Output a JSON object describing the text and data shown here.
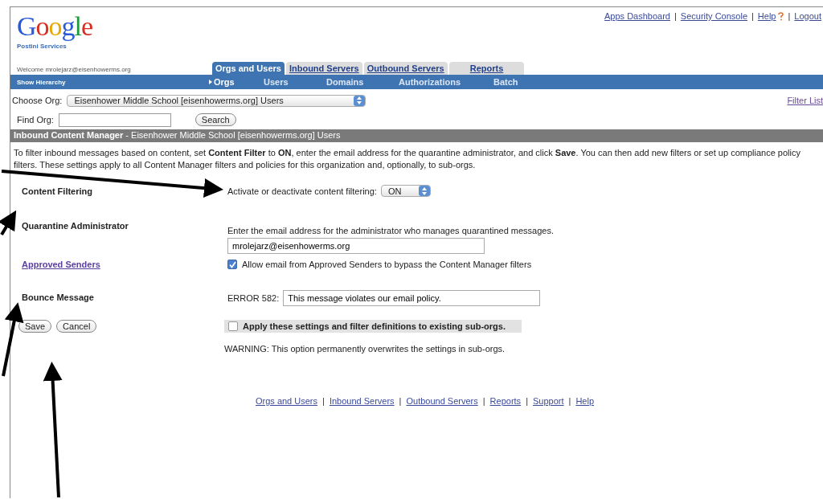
{
  "logo": {
    "wordmark": "Google",
    "subtitle": "Postini Services"
  },
  "link_separator": "|",
  "top_links": [
    "Apps Dashboard",
    "Security Console",
    "Help",
    "Logout"
  ],
  "welcome": "Welcome mrolejarz@eisenhowerms.org",
  "tabs": [
    {
      "label": "Orgs and Users",
      "selected": true
    },
    {
      "label": "Inbound Servers",
      "selected": false
    },
    {
      "label": "Outbound Servers",
      "selected": false
    },
    {
      "label": "Reports",
      "selected": false
    }
  ],
  "show_hierarchy": "Show Hierarchy",
  "subnav": [
    {
      "label": "Orgs",
      "selected": true
    },
    {
      "label": "Users",
      "selected": false
    },
    {
      "label": "Domains",
      "selected": false
    },
    {
      "label": "Authorizations",
      "selected": false
    },
    {
      "label": "Batch",
      "selected": false
    }
  ],
  "choose_org": {
    "label": "Choose Org:",
    "value": "Eisenhower Middle School [eisenhowerms.org] Users"
  },
  "filter_list": "Filter List",
  "find_org": {
    "label": "Find Org:",
    "button": "Search"
  },
  "section_title": "**Inbound Content Manager** - Eisenhower Middle School [eisenhowerms.org] Users",
  "intro": "To filter inbound messages based on content, set **Content Filter** to **ON**, enter the email address for the quarantine administrator, and click **Save**. You can then add new filters or set up compliance policy filters. These settings apply to all Content Manager filters and policies for this organization and, optionally, to sub-orgs.",
  "rows": [
    {
      "kind": "select",
      "label": "Content Filtering",
      "link": false,
      "text": "Activate or deactivate content filtering:",
      "value": "ON"
    },
    {
      "kind": "email",
      "label": "Quarantine Administrator",
      "link": false,
      "text": "Enter the email address for the administrator who manages quarantined messages.",
      "value": "mrolejarz@eisenhowerms.org"
    },
    {
      "kind": "checkbox",
      "label": "Approved Senders",
      "link": true,
      "text": "Allow email from Approved Senders to bypass the Content Manager filters",
      "checked": true
    },
    {
      "kind": "bounce",
      "label": "Bounce Message",
      "link": false,
      "text": "ERROR 582:",
      "value": "This message violates our email policy."
    }
  ],
  "buttons": [
    "Save",
    "Cancel"
  ],
  "apply": {
    "label": "Apply these settings and filter definitions to existing sub-orgs.",
    "checked": false
  },
  "warning": "WARNING: This option permanently overwrites the settings in sub-orgs.",
  "footer_links": [
    "Orgs and Users",
    "Inbound Servers",
    "Outbound Servers",
    "Reports",
    "Support",
    "Help"
  ]
}
